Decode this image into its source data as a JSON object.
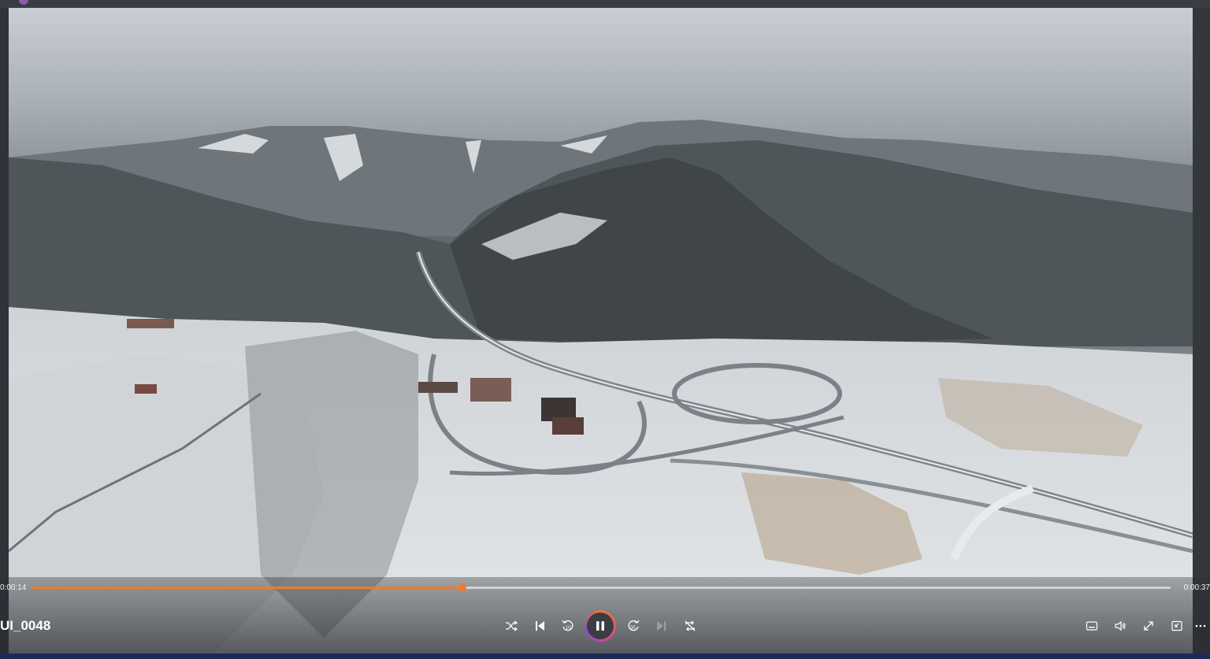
{
  "window": {
    "app_icon": "media-player-icon"
  },
  "player": {
    "media_name": "UI_0048",
    "time_current": "0:00:14",
    "time_total": "0:00:37",
    "progress": 0.3784,
    "state": "playing",
    "accent_color": "#f07a2c"
  },
  "controls": {
    "shuffle": "shuffle-icon",
    "previous": "previous-icon",
    "rewind": "rewind-10-icon",
    "pause": "pause-icon",
    "forward": "forward-30-icon",
    "next": "next-icon",
    "repeat": "repeat-off-icon",
    "captions": "captions-icon",
    "volume": "volume-icon",
    "fullscreen": "fullscreen-icon",
    "miniplayer": "miniplayer-icon",
    "more": "more-icon"
  }
}
